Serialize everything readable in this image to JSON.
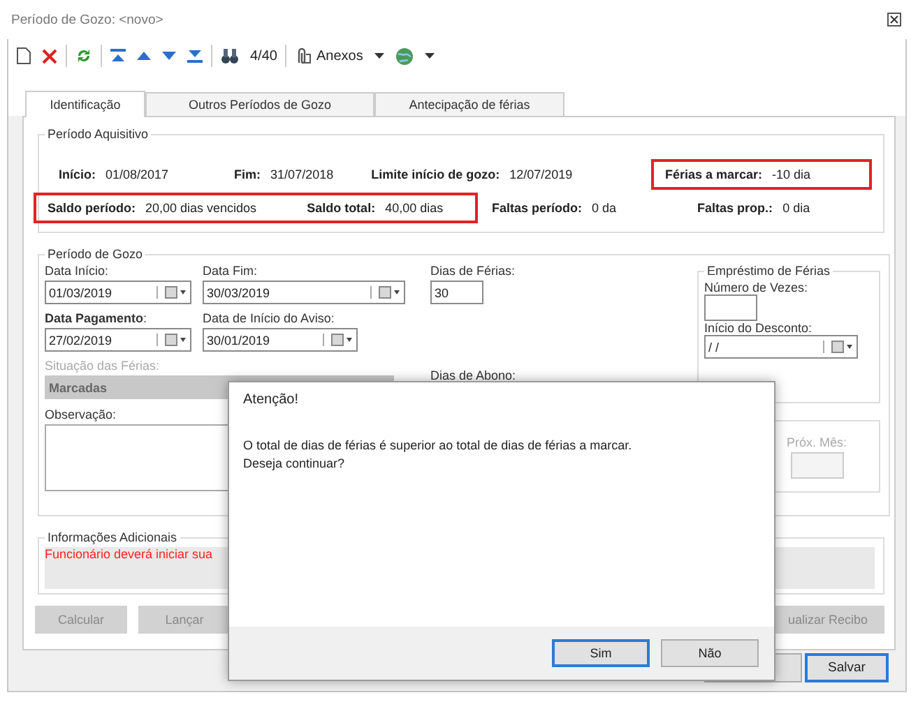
{
  "window": {
    "title": "Período de Gozo: <novo>"
  },
  "toolbar": {
    "record_counter": "4/40",
    "attachments": "Anexos"
  },
  "tabs": [
    {
      "label": "Identificação",
      "selected": true
    },
    {
      "label": "Outros Períodos de Gozo",
      "selected": false
    },
    {
      "label": "Antecipação de férias",
      "selected": false
    }
  ],
  "acquisition_period": {
    "title": "Período Aquisitivo",
    "rows": [
      [
        {
          "highlighted": false,
          "fields": [
            {
              "label": "Início:",
              "value": "01/08/2017"
            },
            {
              "label": "Fim:",
              "value": "31/07/2018"
            },
            {
              "label": "Limite início de gozo:",
              "value": "12/07/2019"
            }
          ]
        },
        {
          "highlighted": true,
          "fields": [
            {
              "label": "Férias a marcar:",
              "value": "-10 dia"
            }
          ]
        }
      ],
      [
        {
          "highlighted": true,
          "fields": [
            {
              "label": "Saldo período:",
              "value": "20,00 dias vencidos"
            },
            {
              "label": "Saldo total:",
              "value": "40,00 dias"
            }
          ]
        },
        {
          "highlighted": false,
          "fields": [
            {
              "label": "Faltas período:",
              "value": "0 da"
            },
            {
              "label": "Faltas prop.:",
              "value": "0 dia"
            }
          ]
        }
      ]
    ]
  },
  "enjoyment_period": {
    "title": "Período de Gozo",
    "start_date": {
      "label": "Data Início:",
      "value": "01/03/2019"
    },
    "end_date": {
      "label": "Data Fim:",
      "value": "30/03/2019"
    },
    "vacation_days": {
      "label": "Dias de Férias:",
      "value": "30"
    },
    "payment_date": {
      "label": "**Data Pagamento**:",
      "value": "27/02/2019"
    },
    "notice_date": {
      "label": "Data de Início do Aviso:",
      "value": "30/01/2019"
    },
    "allowance_days": {
      "label": "Dias de Abono:"
    },
    "situation": {
      "label": "Situação das Férias:",
      "value": "Marcadas",
      "disabled": true
    },
    "notes": {
      "label": "Observação:"
    },
    "loan": {
      "title": "Empréstimo de Férias",
      "times_label": "Número de Vezes:",
      "discount_label": "Início do Desconto:",
      "discount_value": "/ /"
    },
    "next_month": {
      "label": "Próx. Mês:",
      "disabled": true
    }
  },
  "additional_info": {
    "title": "Informações Adicionais",
    "message": "Funcionário deverá iniciar sua"
  },
  "actions": [
    {
      "label": "Calcular",
      "disabled": true
    },
    {
      "label": "Lançar",
      "disabled": true
    },
    {
      "label": "ualizar Recibo",
      "disabled": true
    }
  ],
  "footer_buttons": [
    {
      "kind": "plain"
    },
    {
      "kind": "default",
      "label": "Salvar"
    }
  ],
  "dialog": {
    "title": "Atenção!",
    "message": [
      "O total de dias de férias é superior ao total de dias de férias a marcar.",
      "Deseja continuar?"
    ],
    "buttons": [
      {
        "label": "Sim",
        "focused": true
      },
      {
        "label": "Não",
        "focused": false
      }
    ]
  }
}
